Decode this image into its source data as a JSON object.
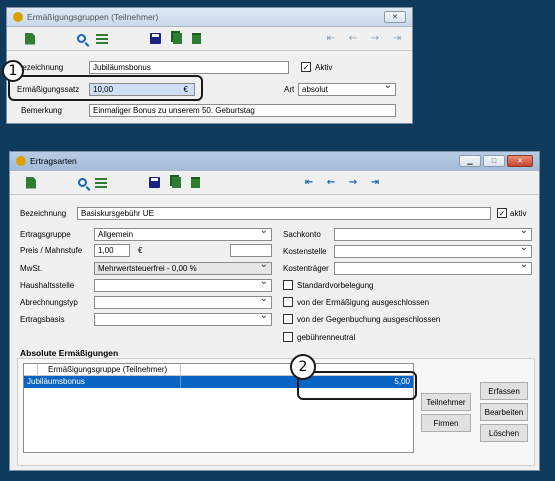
{
  "win1": {
    "title": "Ermäßigungsgruppen (Teilnehmer)",
    "fields": {
      "bezeichnung_label": "Bezeichnung",
      "bezeichnung_value": "Jubiläumsbonus",
      "aktiv_label": "Aktiv",
      "ermaessigungssatz_label": "Ermäßigungssatz",
      "ermaessigungssatz_value": "10,00",
      "currency": "€",
      "art_label": "Art",
      "art_value": "absolut",
      "bemerkung_label": "Bemerkung",
      "bemerkung_value": "Einmaliger Bonus zu unserem 50. Geburtstag"
    },
    "callout": "1"
  },
  "win2": {
    "title": "Ertragsarten",
    "fields": {
      "bezeichnung_label": "Bezeichnung",
      "bezeichnung_value": "Basiskursgebühr UE",
      "aktiv_label": "aktiv",
      "ertragsgruppe_label": "Ertragsgruppe",
      "ertragsgruppe_value": "Allgemein",
      "preis_label": "Preis / Mahnstufe",
      "preis_value": "1,00",
      "currency": "€",
      "mwst_label": "MwSt.",
      "mwst_value": "Mehrwertsteuerfrei - 0,00 %",
      "haushaltsstelle_label": "Haushaltsstelle",
      "abrechnungstyp_label": "Abrechnungstyp",
      "ertragsbasis_label": "Ertragsbasis",
      "sachkonto_label": "Sachkonto",
      "kostenstelle_label": "Kostenstelle",
      "kostentraeger_label": "Kostenträger",
      "standardvorbelegung_label": "Standardvorbelegung",
      "ausgeschlossen_label": "von der Ermäßigung ausgeschlossen",
      "gegenbuchung_label": "von der Gegenbuchung ausgeschlossen",
      "gebuehrenneutral_label": "gebührenneutral"
    },
    "group_title": "Absolute Ermäßigungen",
    "grid": {
      "header": "Ermäßigungsgruppe (Teilnehmer)",
      "row_name": "Jubiläumsbonus",
      "row_value": "5,00"
    },
    "buttons": {
      "teilnehmer": "Teilnehmer",
      "firmen": "Firmen",
      "erfassen": "Erfassen",
      "bearbeiten": "Bearbeiten",
      "loeschen": "Löschen"
    },
    "callout": "2"
  }
}
